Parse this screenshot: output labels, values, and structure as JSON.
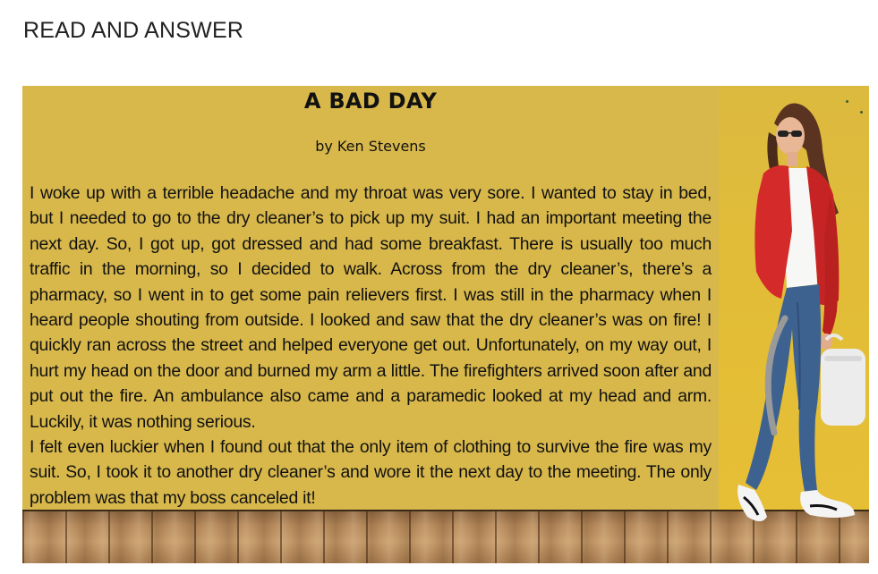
{
  "header": {
    "title": "READ AND ANSWER"
  },
  "slide": {
    "title": "A BAD DAY",
    "author": "by Ken Stevens",
    "paragraphs": [
      "I woke up with a terrible headache and my throat was very sore. I wanted to stay in bed, but I needed to go to the dry cleaner’s to pick up my suit. I had an important meeting the next day. So, I got up, got dressed and had some breakfast. There is usually too much traffic in the morning, so I decided to walk. Across from the dry cleaner’s, there’s a pharmacy, so I went in to get some pain relievers first. I was still in the pharmacy when I heard people shouting from outside. I looked and saw that the dry cleaner’s was on fire! I quickly ran across the street and helped everyone get out. Unfortunately, on my way out, I hurt my head on the door and burned my arm a little. The firefighters arrived soon after and put out the fire. An ambulance also came and a paramedic looked at my head and arm. Luckily, it was nothing serious.",
      "I felt even luckier when I found out that the only item of clothing to survive the fire was my suit. So, I took it to another dry cleaner’s and wore it the next day to the meeting. The only problem was that my boss canceled it!"
    ]
  },
  "colors": {
    "slide_background": "#d8b84b",
    "jacket": "#d42a2a",
    "jeans": "#3e6290"
  },
  "illustration": {
    "icon": "walking-woman-illustration"
  }
}
